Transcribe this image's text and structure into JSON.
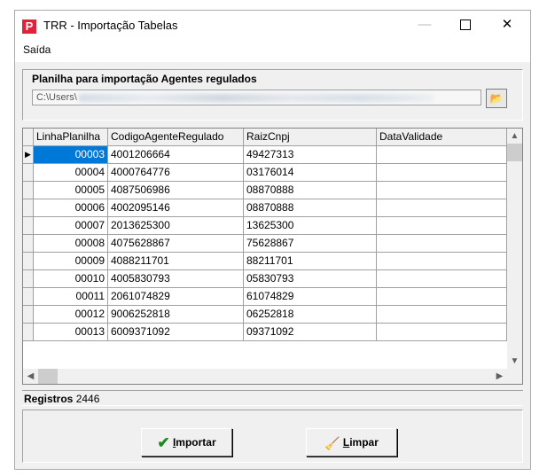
{
  "window": {
    "title": "TRR - Importação Tabelas",
    "icon": "P"
  },
  "menu": {
    "items": [
      "Saída"
    ]
  },
  "import_group": {
    "title": "Planilha para importação Agentes regulados",
    "path_prefix": "C:\\Users\\"
  },
  "grid": {
    "columns": [
      "LinhaPlanilha",
      "CodigoAgenteRegulado",
      "RaizCnpj",
      "DataValidade"
    ],
    "rows": [
      [
        "00003",
        "4001206664",
        "49427313",
        ""
      ],
      [
        "00004",
        "4000764776",
        "03176014",
        ""
      ],
      [
        "00005",
        "4087506986",
        "08870888",
        ""
      ],
      [
        "00006",
        "4002095146",
        "08870888",
        ""
      ],
      [
        "00007",
        "2013625300",
        "13625300",
        ""
      ],
      [
        "00008",
        "4075628867",
        "75628867",
        ""
      ],
      [
        "00009",
        "4088211701",
        "88211701",
        ""
      ],
      [
        "00010",
        "4005830793",
        "05830793",
        ""
      ],
      [
        "00011",
        "2061074829",
        "61074829",
        ""
      ],
      [
        "00012",
        "9006252818",
        "06252818",
        ""
      ],
      [
        "00013",
        "6009371092",
        "09371092",
        ""
      ]
    ]
  },
  "status": {
    "label": "Registros",
    "count": "2446"
  },
  "buttons": {
    "importar_first": "I",
    "importar_rest": "mportar",
    "limpar_first": "L",
    "limpar_rest": "impar"
  }
}
